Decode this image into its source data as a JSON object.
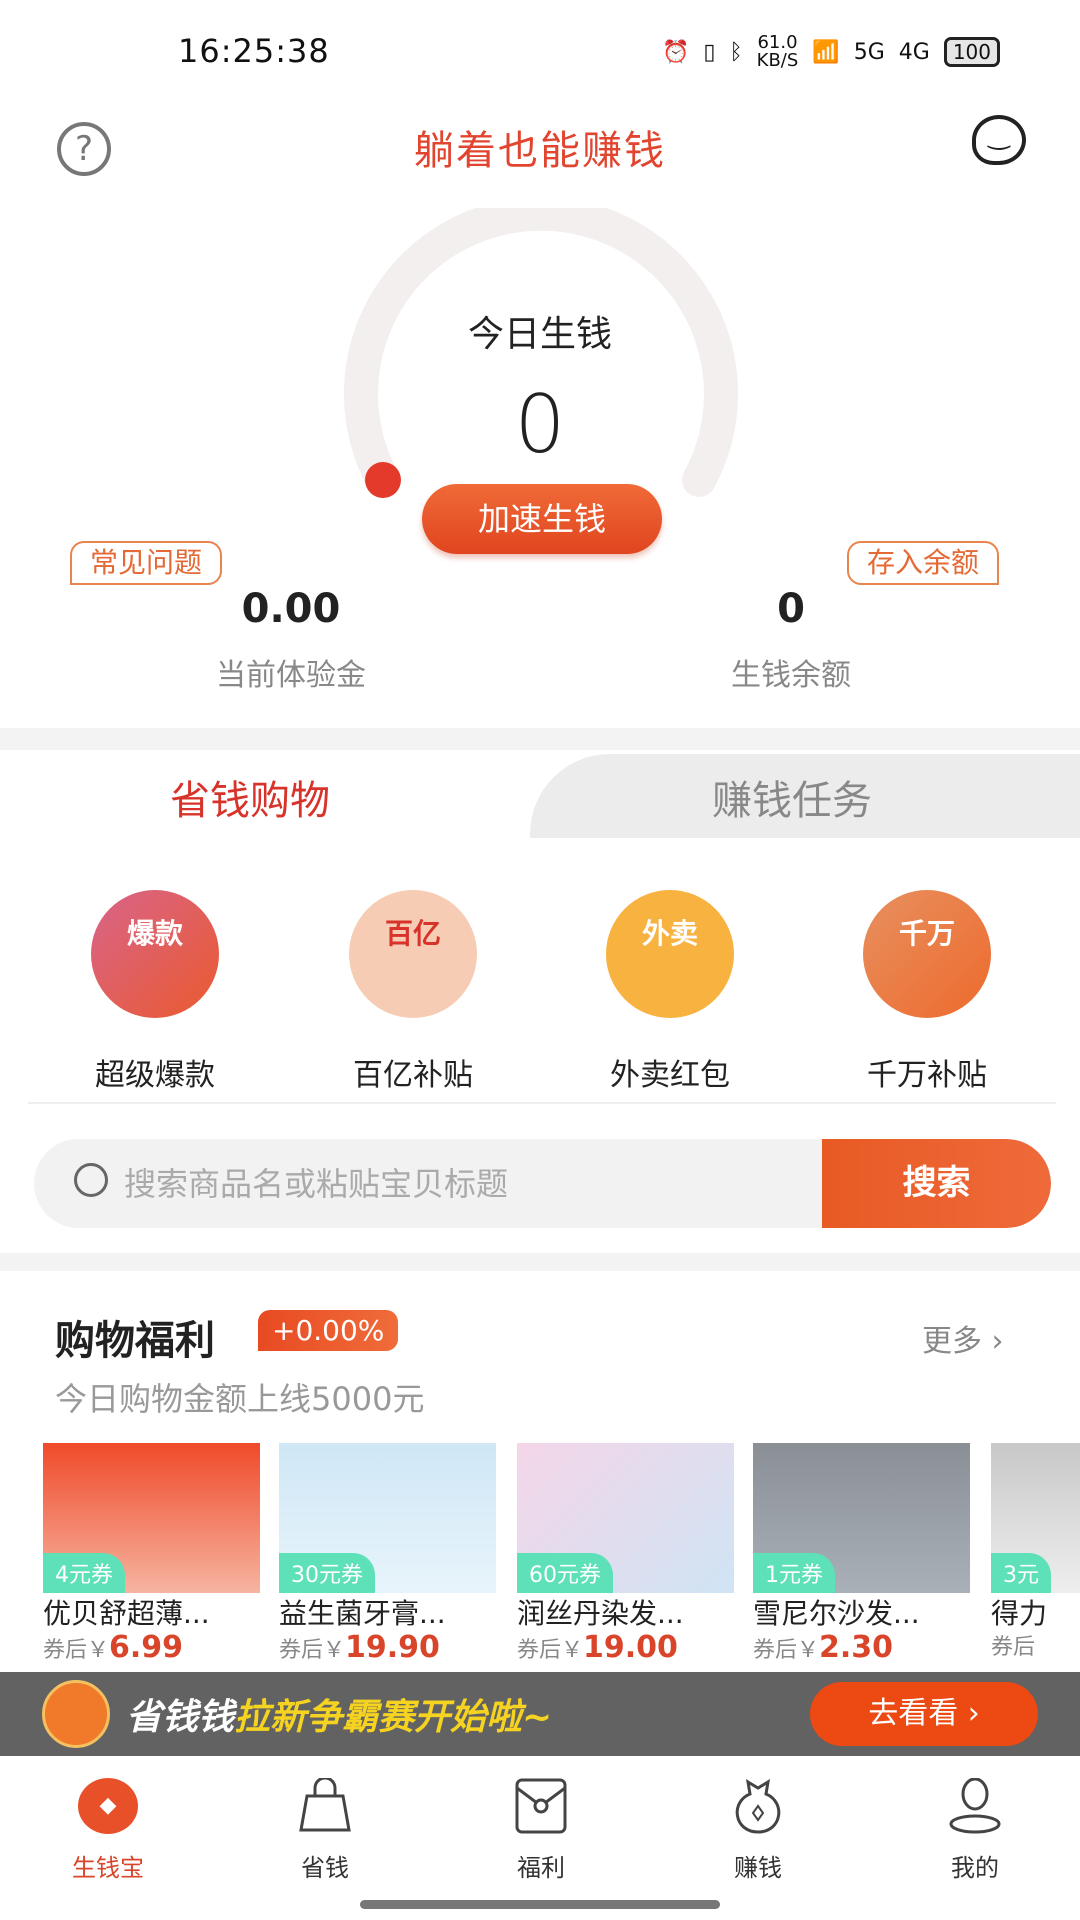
{
  "status_bar": {
    "time": "16:25:38",
    "net_speed": "61.0",
    "net_unit": "KB/S",
    "battery": "100",
    "signal_5g": "5G",
    "signal_4g": "4G"
  },
  "header": {
    "title": "躺着也能赚钱"
  },
  "gauge": {
    "label": "今日生钱",
    "value": "0",
    "speed_button": "加速生钱"
  },
  "stats": {
    "faq_badge": "常见问题",
    "deposit_badge": "存入余额",
    "trial_value": "0.00",
    "trial_label": "当前体验金",
    "balance_value": "0",
    "balance_label": "生钱余额"
  },
  "tabs": [
    {
      "label": "省钱购物",
      "active": true
    },
    {
      "label": "赚钱任务",
      "active": false
    }
  ],
  "categories": [
    {
      "icon_text": "爆款",
      "label": "超级爆款"
    },
    {
      "icon_text": "百亿",
      "label": "百亿补贴"
    },
    {
      "icon_text": "外卖",
      "label": "外卖红包"
    },
    {
      "icon_text": "千万",
      "label": "千万补贴"
    }
  ],
  "search": {
    "placeholder": "搜索商品名或粘贴宝贝标题",
    "button": "搜索"
  },
  "welfare": {
    "title": "购物福利",
    "rate": "+0.00%",
    "more": "更多",
    "subtitle": "今日购物金额上线5000元"
  },
  "products": [
    {
      "coupon": "4元券",
      "name": "优贝舒超薄...",
      "price_prefix": "券后￥",
      "price": "6.99"
    },
    {
      "coupon": "30元券",
      "name": "益生菌牙膏...",
      "price_prefix": "券后￥",
      "price": "19.90"
    },
    {
      "coupon": "60元券",
      "name": "润丝丹染发...",
      "price_prefix": "券后￥",
      "price": "19.00"
    },
    {
      "coupon": "1元券",
      "name": "雪尼尔沙发...",
      "price_prefix": "券后￥",
      "price": "2.30"
    },
    {
      "coupon": "3元",
      "name": "得力",
      "price_prefix": "券后",
      "price": ""
    }
  ],
  "promo": {
    "text_white": "省钱钱",
    "text_yellow": "拉新争霸赛开始啦~",
    "button": "去看看"
  },
  "bottom_nav": [
    {
      "label": "生钱宝",
      "active": true
    },
    {
      "label": "省钱",
      "active": false
    },
    {
      "label": "福利",
      "active": false
    },
    {
      "label": "赚钱",
      "active": false
    },
    {
      "label": "我的",
      "active": false
    }
  ],
  "colors": {
    "accent": "#e2452f",
    "promo_yellow": "#f5d320",
    "coupon": "#5ee0b8"
  }
}
